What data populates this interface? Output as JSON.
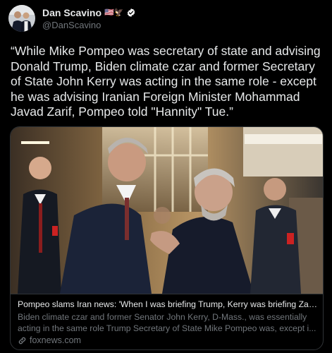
{
  "author": {
    "display_name": "Dan Scavino",
    "emoji": "🇺🇸🦅",
    "handle": "@DanScavino",
    "verified_icon": "verified-badge-icon",
    "avatar_icon": "avatar"
  },
  "tweet": {
    "text": "“While Mike Pompeo was secretary of state and advising Donald Trump, Biden climate czar and former Secretary of State John Kerry was acting in the same role - except he was advising Iranian Foreign Minister Mohammad Javad Zarif, Pompeo told \"Hannity\" Tue.”"
  },
  "link_card": {
    "title": "Pompeo slams Iran news: 'When I was briefing Trump, Kerry was briefing Zarif'",
    "description": "Biden climate czar and former Senator John Kerry, D-Mass., was essentially acting in the same role Trump Secretary of State Mike Pompeo was, except i...",
    "domain": "foxnews.com",
    "domain_icon": "link-icon"
  },
  "colors": {
    "background": "#000000",
    "text_primary": "#e7e9ea",
    "text_secondary": "#71767b",
    "border": "#2f3336",
    "verified_badge": "#ffffff"
  }
}
